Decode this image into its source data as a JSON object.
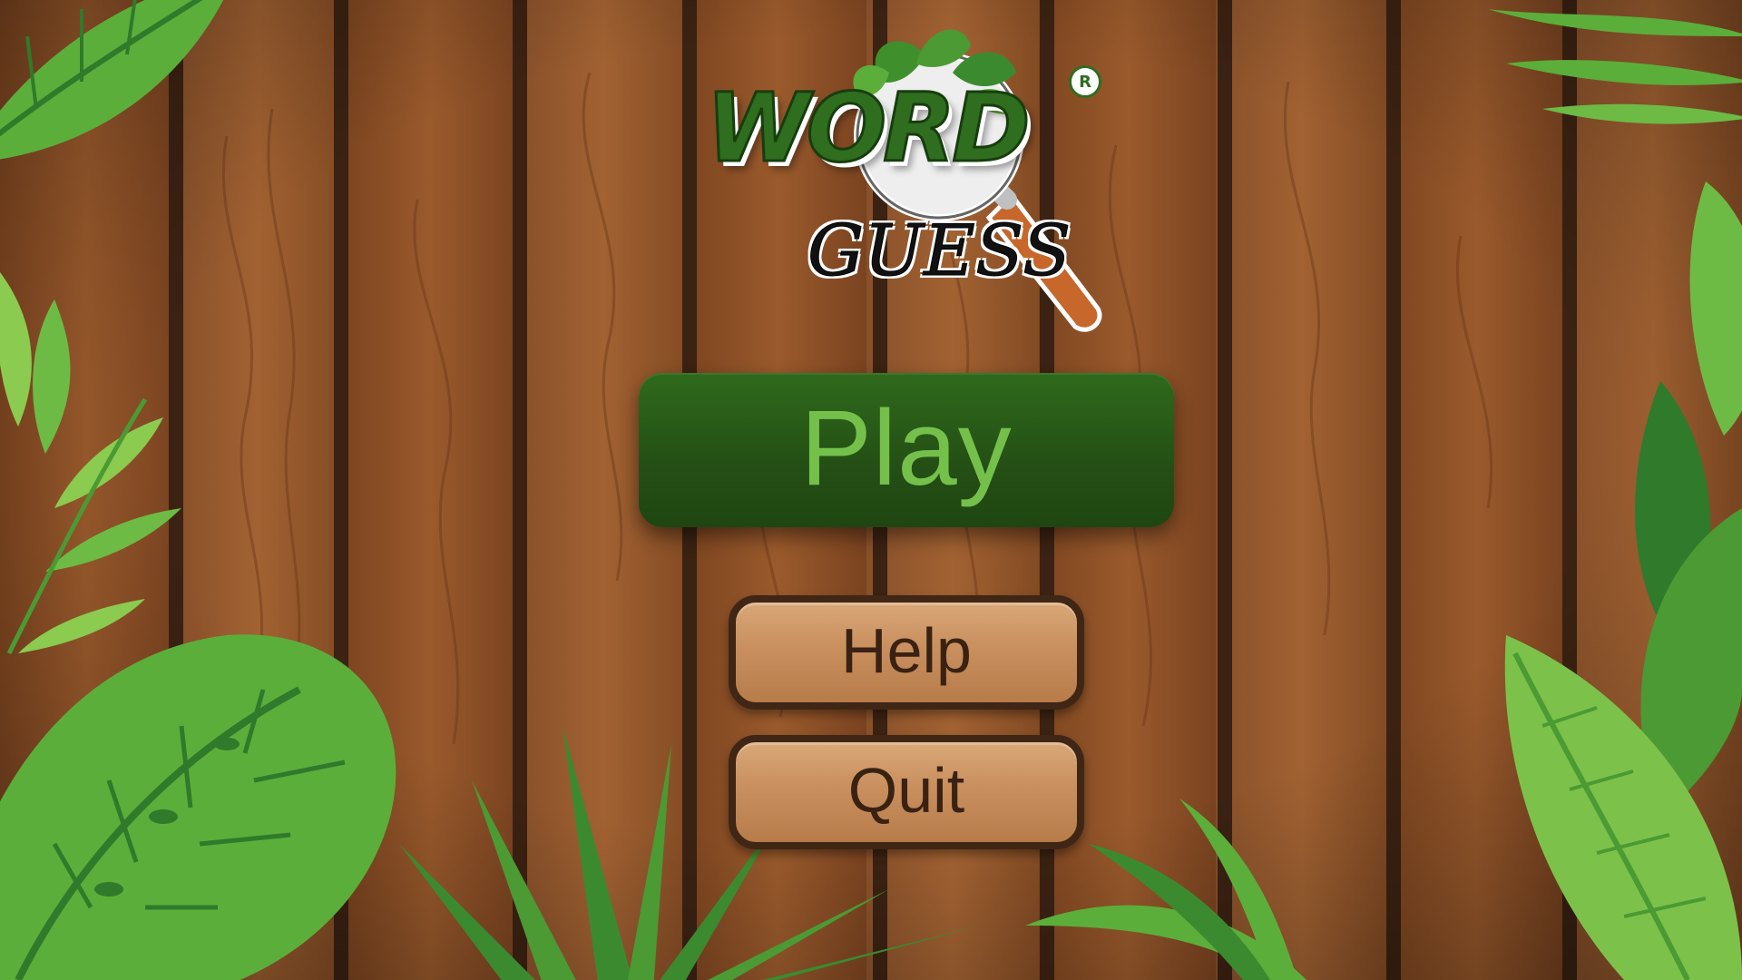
{
  "logo": {
    "word": "WORD",
    "guess": "GUESS",
    "registered_mark": "R"
  },
  "menu": {
    "play_label": "Play",
    "help_label": "Help",
    "quit_label": "Quit"
  },
  "colors": {
    "play_bg": "#244f15",
    "play_text": "#74c04b",
    "wood_button": "#c98f5e",
    "wood_border": "#3f2615",
    "plank": "#8a4f24",
    "plank_seam": "#3b2212",
    "leaf_light": "#7cc24a",
    "leaf_dark": "#2f7a2b"
  }
}
